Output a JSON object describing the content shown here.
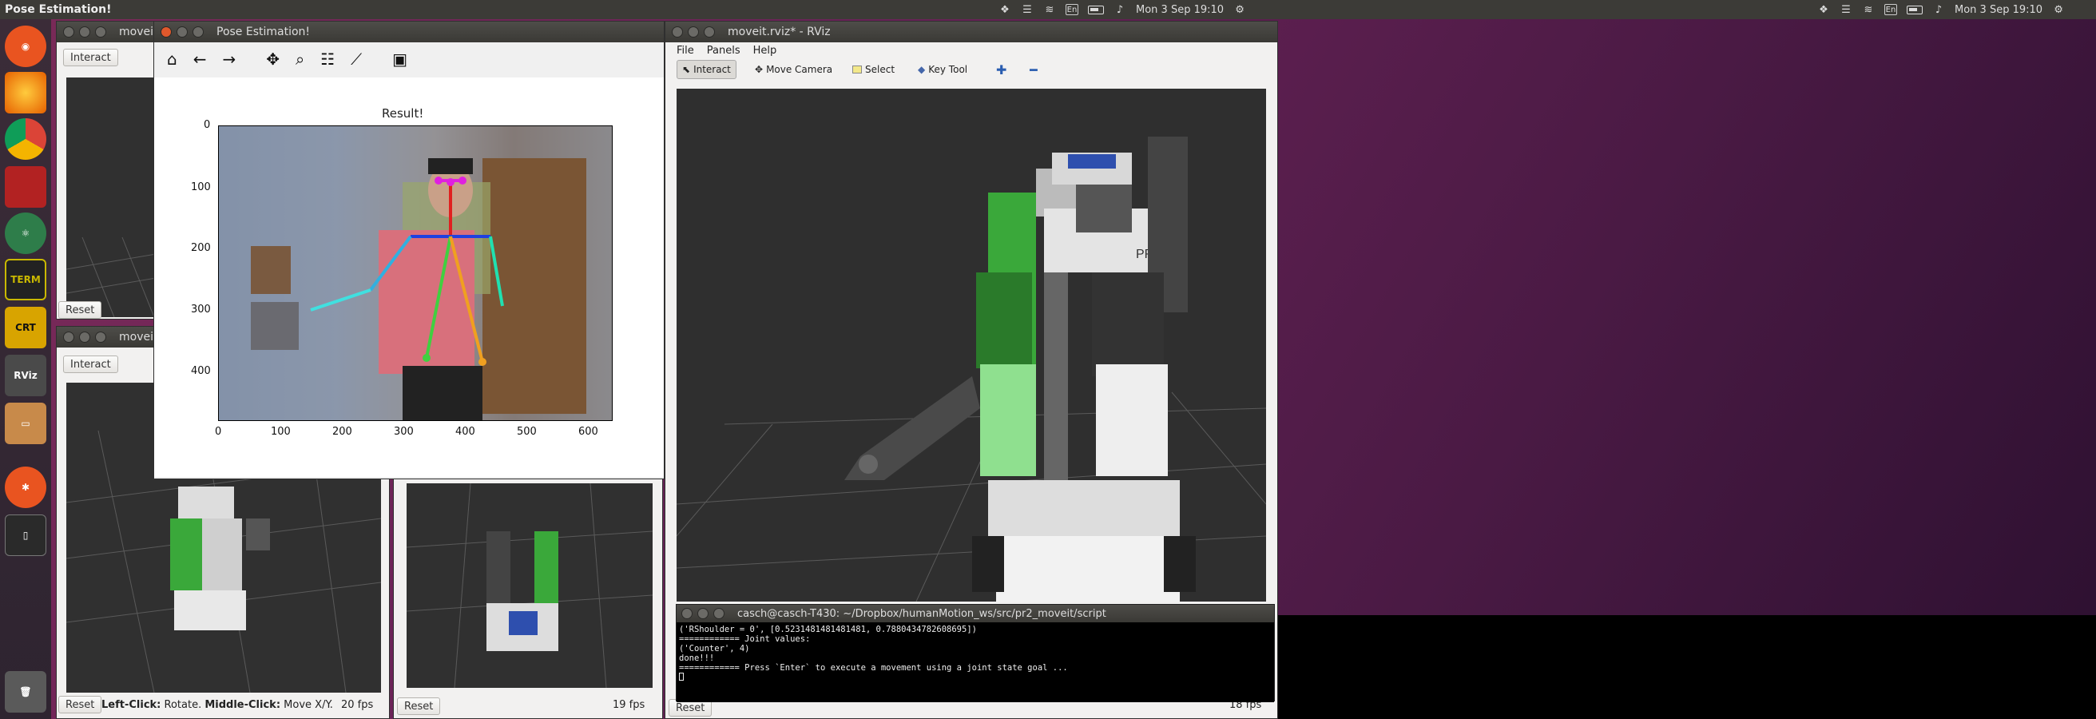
{
  "topbar": {
    "active_app": "Pose Estimation!",
    "clock": "Mon 3 Sep 19:10",
    "kbd": "En"
  },
  "launcher": {
    "items": [
      "ubuntu",
      "firefox",
      "chrome",
      "app-red",
      "atom",
      "terminal",
      "crt",
      "rviz",
      "files",
      "tool",
      "phone",
      "trash"
    ],
    "crt_label": "CRT",
    "rviz_label": "RViz",
    "term_label": "TERM"
  },
  "bg_windows": {
    "top_left": {
      "title": "moveit",
      "interact": "Interact",
      "reset": "Reset"
    },
    "mid_left": {
      "title": "moveit",
      "interact": "Interact",
      "reset": "Reset",
      "status_left": "Left-Click:",
      "status_rotate": " Rotate. ",
      "status_middle": "Middle-Click:",
      "status_move": " Move X/Y.",
      "fps": "20 fps"
    },
    "mid_right": {
      "reset": "Reset",
      "fps": "19 fps"
    }
  },
  "mpl": {
    "title": "Pose Estimation!",
    "plot_title": "Result!",
    "yticks": [
      "0",
      "100",
      "200",
      "300",
      "400"
    ],
    "xticks": [
      "0",
      "100",
      "200",
      "300",
      "400",
      "500",
      "600"
    ]
  },
  "rviz": {
    "title": "moveit.rviz* - RViz",
    "menu": [
      "File",
      "Panels",
      "Help"
    ],
    "tools": [
      "Interact",
      "Move Camera",
      "Select",
      "Key Tool"
    ],
    "robot_label": "PR2",
    "fps": "18 fps",
    "reset": "Reset"
  },
  "terminal": {
    "title": "casch@casch-T430: ~/Dropbox/humanMotion_ws/src/pr2_moveit/script",
    "lines": [
      "('RShoulder = 0', [0.5231481481481481, 0.7880434782608695])",
      "============ Joint values:",
      "('Counter', 4)",
      "done!!!",
      "",
      "============ Press `Enter` to execute a movement using a joint state goal ..."
    ]
  },
  "colors": {
    "panel": "#3c3b37",
    "desktop": "#6a2358",
    "rviz_bg": "#303030",
    "green_arm": "#3aa83a"
  }
}
